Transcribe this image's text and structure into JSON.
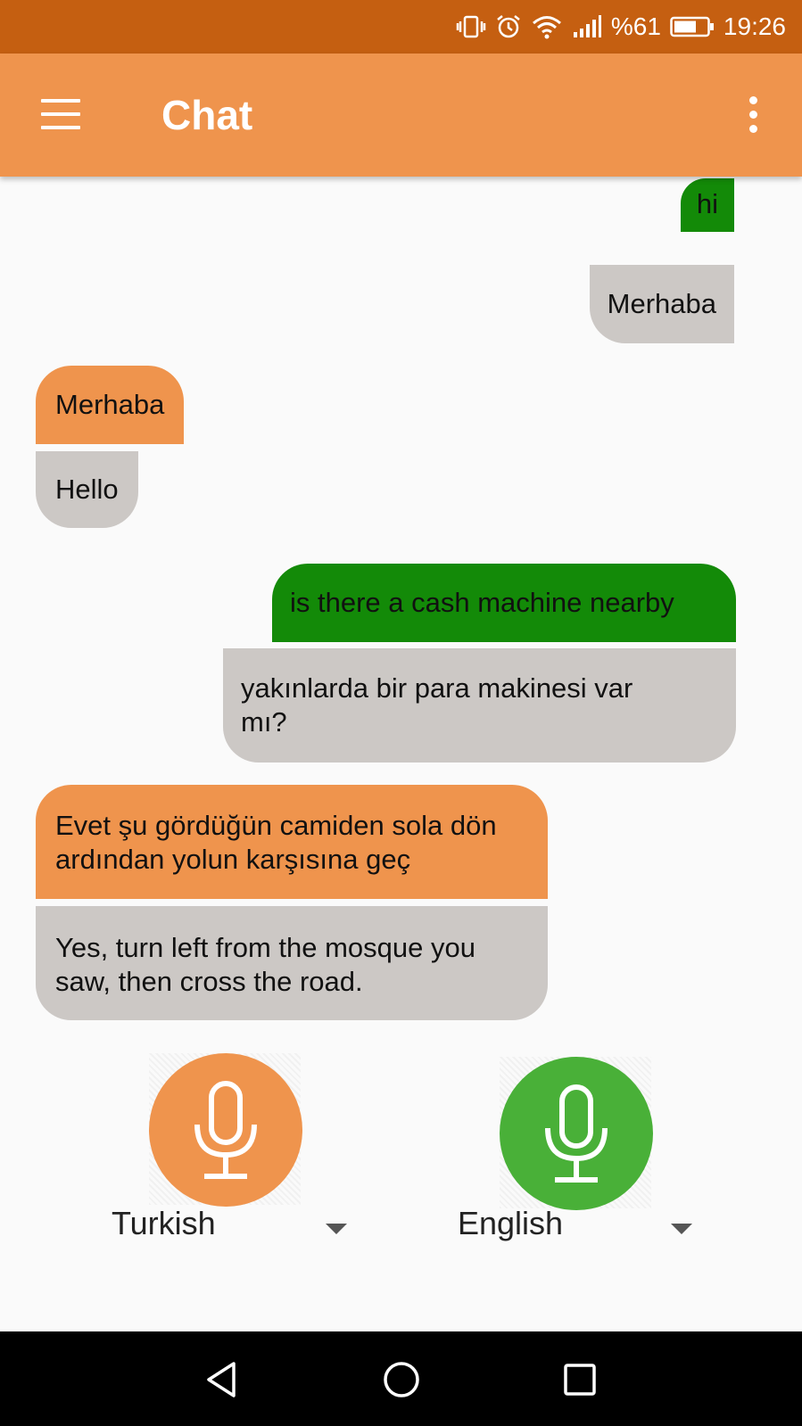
{
  "status_bar": {
    "battery_percent": "%61",
    "time": "19:26",
    "icons": [
      "vibrate-icon",
      "alarm-icon",
      "wifi-icon",
      "signal-icon",
      "battery-icon"
    ]
  },
  "app_bar": {
    "title": "Chat",
    "menu_icon": "hamburger-menu-icon",
    "more_icon": "more-vert-icon"
  },
  "colors": {
    "status_bar": "#c55f11",
    "app_bar": "#ef944d",
    "green_bubble": "#138a08",
    "orange_bubble": "#ef944d",
    "gray_bubble": "#ccc8c5",
    "mic_green": "#49b038",
    "mic_orange": "#ef944d"
  },
  "messages": [
    {
      "side": "right",
      "color": "green",
      "original": "hi",
      "translation": "Merhaba"
    },
    {
      "side": "left",
      "color": "orange",
      "original": "Merhaba",
      "translation": "Hello"
    },
    {
      "side": "right",
      "color": "green",
      "original": "is there a cash machine nearby",
      "translation": "yakınlarda bir para makinesi var mı?"
    },
    {
      "side": "left",
      "color": "orange",
      "original": "Evet şu gördüğün camiden sola dön ardından yolun karşısına geç",
      "translation": "Yes, turn left from the mosque you saw, then cross the road."
    }
  ],
  "controls": {
    "left_language": "Turkish",
    "right_language": "English",
    "left_mic_icon": "microphone-icon",
    "right_mic_icon": "microphone-icon",
    "dropdown_icon": "dropdown-arrow-icon"
  },
  "nav_bar": {
    "back_icon": "back-icon",
    "home_icon": "home-icon",
    "recents_icon": "recents-icon"
  }
}
